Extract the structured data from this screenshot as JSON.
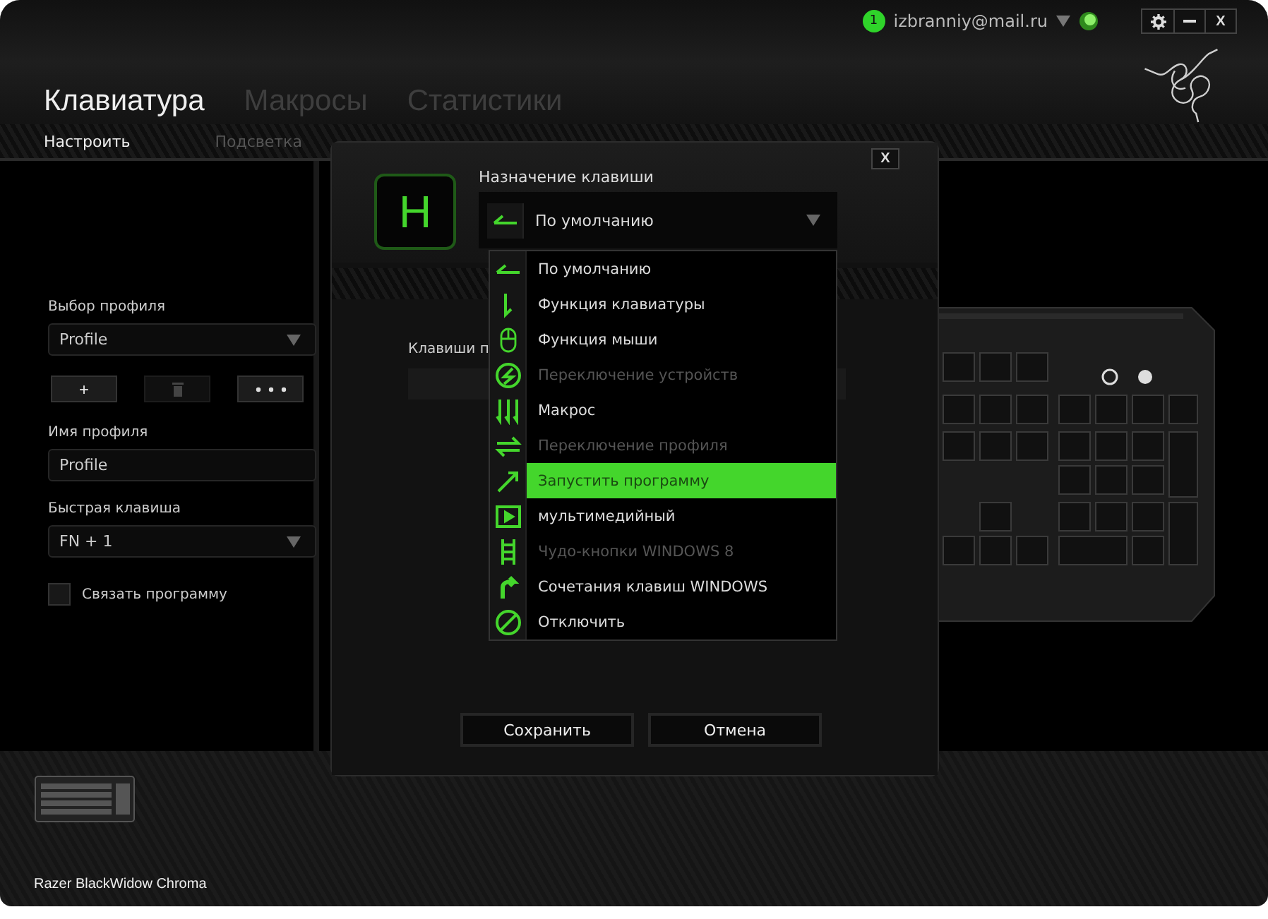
{
  "account": {
    "notifications": "1",
    "email": "izbranniy@mail.ru"
  },
  "window_controls": {
    "close": "X"
  },
  "tabs": [
    {
      "label": "Клавиатура",
      "selected": true
    },
    {
      "label": "Макросы",
      "selected": false
    },
    {
      "label": "Статистики",
      "selected": false
    }
  ],
  "subtabs": [
    {
      "label": "Настроить",
      "selected": true
    },
    {
      "label": "Подсветка",
      "selected": false
    }
  ],
  "sidebar": {
    "profile_label": "Выбор профиля",
    "profile_select": "Profile",
    "add_button": "+",
    "delete_button": {
      "disabled": true
    },
    "name_label": "Имя профиля",
    "name_value": "Profile",
    "hotkey_label": "Быстрая клавиша",
    "hotkey_select": "FN + 1",
    "link_program": {
      "label": "Связать программу",
      "checked": false
    }
  },
  "device": {
    "name": "Razer BlackWidow Chroma"
  },
  "dialog": {
    "close": "X",
    "key": "H",
    "title": "Назначение клавиши",
    "current": {
      "kind": "default",
      "label": "По умолчанию"
    },
    "keys_label": "Клавиши п",
    "menu": [
      {
        "kind": "default",
        "label": "По умолчанию",
        "disabled": false,
        "selected": false
      },
      {
        "kind": "keyboard",
        "label": "Функция клавиатуры",
        "disabled": false,
        "selected": false
      },
      {
        "kind": "mouse",
        "label": "Функция мыши",
        "disabled": false,
        "selected": false
      },
      {
        "kind": "device",
        "label": "Переключение устройств",
        "disabled": true,
        "selected": false
      },
      {
        "kind": "macro",
        "label": "Макрос",
        "disabled": false,
        "selected": false
      },
      {
        "kind": "profile",
        "label": "Переключение профиля",
        "disabled": true,
        "selected": false
      },
      {
        "kind": "launch",
        "label": "Запустить программу",
        "disabled": false,
        "selected": true
      },
      {
        "kind": "media",
        "label": "мультимедийный",
        "disabled": false,
        "selected": false
      },
      {
        "kind": "charms",
        "label": "Чудо-кнопки WINDOWS 8",
        "disabled": true,
        "selected": false
      },
      {
        "kind": "shortcut",
        "label": "Сочетания клавиш WINDOWS",
        "disabled": false,
        "selected": false
      },
      {
        "kind": "disable",
        "label": "Отключить",
        "disabled": false,
        "selected": false
      }
    ],
    "buttons": [
      "Сохранить",
      "Отмена"
    ]
  }
}
